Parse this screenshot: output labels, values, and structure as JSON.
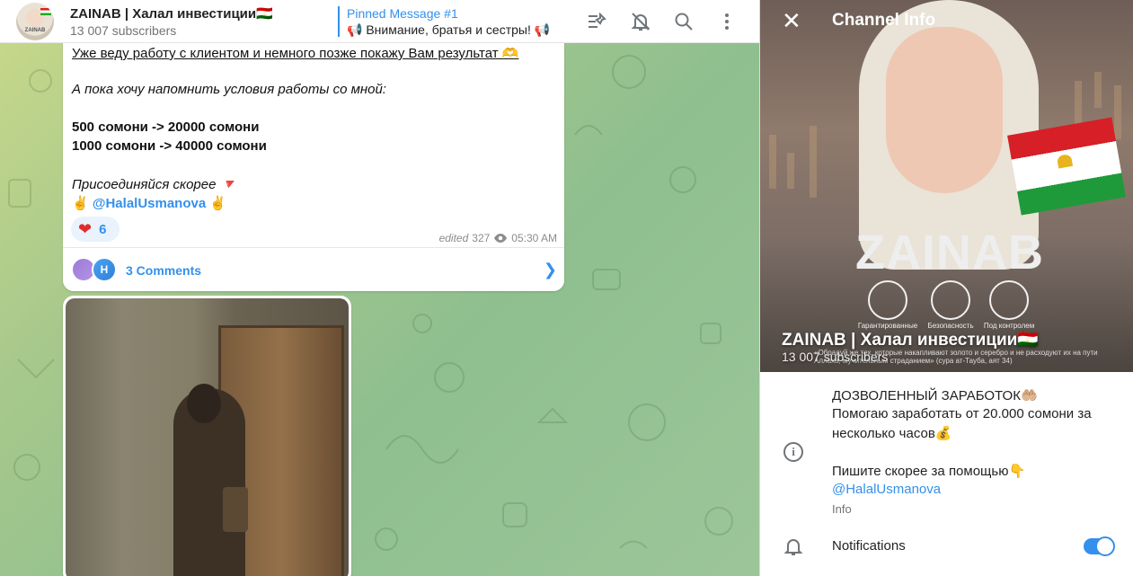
{
  "header": {
    "title": "ZAINAB | Халал инвестиции🇹🇯",
    "subscribers": "13 007 subscribers",
    "avatar_text": "ZAINAB",
    "pinned_title": "Pinned Message #1",
    "pinned_text": "📢 Внимание, братья и сестры! 📢",
    "icons": [
      "pin-list-icon",
      "bell-muted-icon",
      "search-icon",
      "more-vert-icon"
    ]
  },
  "message": {
    "line1": "Уже веду работу с клиентом и немного позже покажу Вам результат 🫶",
    "line2": "А пока хочу напомнить условия работы со мной:",
    "line3": "500 сомони -> 20000 сомони",
    "line4": "1000 сомони -> 40000 сомони",
    "line5": "Присоединяйся скорее 🔻",
    "line6": "✌️ @HalalUsmanova ✌️",
    "reaction_emoji": "❤",
    "reaction_count": "6",
    "edited": "edited",
    "views": "327",
    "time": "05:30 AM",
    "comment_avatar_letter": "H",
    "comments_label": "3 Comments"
  },
  "panel": {
    "title": "Channel Info",
    "hero_brand": "ZAINAB",
    "feature_captions": [
      "Гарантированные",
      "Безопасность",
      "Под контролем"
    ],
    "hero_quote": "«Обрадуй же тех, которые накапливают золото и серебро и не расходуют их на пути Аллаха, мучительным страданием» (сура ат-Тауба, аят 34)",
    "name": "ZAINAB | Халал инвестиции🇹🇯",
    "subscribers": "13 007 subscribers",
    "info_lines": [
      "ДОЗВОЛЕННЫЙ ЗАРАБОТОК🤲🏼",
      "Помогаю заработать от 20.000 сомони за",
      "несколько часов💰",
      "",
      "Пишите скорее за помощью👇",
      "@HalalUsmanova"
    ],
    "info_caption": "Info",
    "notifications_label": "Notifications",
    "notifications_enabled": true
  },
  "colors": {
    "accent": "#3390ec",
    "heart": "#e02c2c",
    "muted": "#707579"
  }
}
